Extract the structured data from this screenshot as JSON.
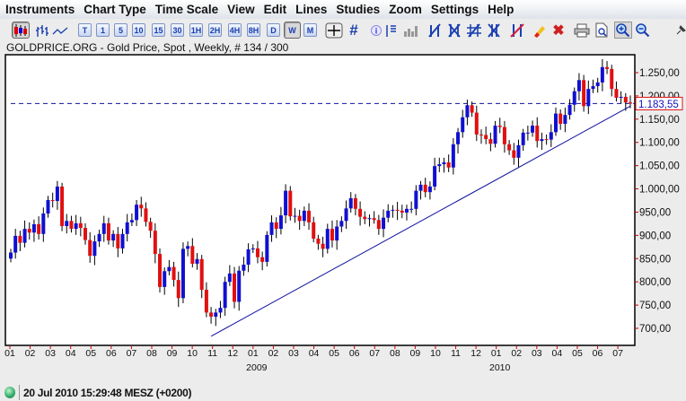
{
  "menu": [
    "Instruments",
    "Chart Type",
    "Time Scale",
    "View",
    "Edit",
    "Lines",
    "Studies",
    "Zoom",
    "Settings",
    "Help"
  ],
  "toolbar": {
    "chart_types": [
      {
        "name": "candlestick-chart-icon",
        "selected": true
      },
      {
        "name": "bar-chart-icon",
        "selected": false
      },
      {
        "name": "line-chart-icon",
        "selected": false
      }
    ],
    "timeframes": [
      {
        "label": "T",
        "selected": false
      },
      {
        "label": "1",
        "selected": false
      },
      {
        "label": "5",
        "selected": false
      },
      {
        "label": "10",
        "selected": false
      },
      {
        "label": "15",
        "selected": false
      },
      {
        "label": "30",
        "selected": false
      },
      {
        "label": "1H",
        "selected": false
      },
      {
        "label": "2H",
        "selected": false
      },
      {
        "label": "4H",
        "selected": false
      },
      {
        "label": "8H",
        "selected": false
      },
      {
        "label": "D",
        "selected": false
      },
      {
        "label": "W",
        "selected": true
      },
      {
        "label": "M",
        "selected": false
      }
    ],
    "tools": [
      "crosshair-icon",
      "grid-icon",
      "info-icon",
      "price-labels-icon",
      "volume-icon",
      "trendline-icon",
      "parallel-lines-icon",
      "fibonacci-icon",
      "fan-lines-icon",
      "channel-icon",
      "eraser-icon",
      "delete-all-icon",
      "print-icon",
      "print-preview-icon",
      "zoom-in-icon",
      "zoom-out-icon",
      "pin-icon"
    ],
    "glyphs": {
      "grid-icon": "#",
      "print-icon": "⎙",
      "pin-icon": "✎",
      "zoom-in-icon": "⊕",
      "zoom-out-icon": "⊖",
      "delete-all-icon": "✖",
      "info-icon": "ⓘ",
      "print-preview-icon": "🗋"
    }
  },
  "subtitle": "GOLDPRICE.ORG - Gold Price, Spot , Weekly, # 134 / 300",
  "colors": {
    "up": "#1010d0",
    "down": "#e01010",
    "trendline": "#1010a0",
    "price_line": "#1010a0",
    "price_box_border": "#e01010"
  },
  "chart_data": {
    "type": "candlestick",
    "instrument": "Gold Price, Spot",
    "interval": "Weekly",
    "ylim": [
      680,
      1275
    ],
    "y_ticks": [
      "700,00",
      "750,00",
      "800,00",
      "850,00",
      "900,00",
      "950,00",
      "1.000,00",
      "1.050,00",
      "1.100,00",
      "1.150,00",
      "1.200,00",
      "1.250,00"
    ],
    "y_tick_values": [
      700,
      750,
      800,
      850,
      900,
      950,
      1000,
      1050,
      1100,
      1150,
      1200,
      1250
    ],
    "x_month_labels": [
      "01",
      "02",
      "03",
      "04",
      "05",
      "06",
      "07",
      "08",
      "09",
      "10",
      "11",
      "12",
      "01",
      "02",
      "03",
      "04",
      "05",
      "06",
      "07",
      "08",
      "09",
      "10",
      "11",
      "12",
      "01",
      "02",
      "03",
      "04",
      "05",
      "06",
      "07"
    ],
    "x_year_labels": [
      {
        "label": "2009",
        "month_index": 12
      },
      {
        "label": "2010",
        "month_index": 24
      }
    ],
    "first_week_open": 850,
    "closes": [
      863,
      899,
      884,
      914,
      906,
      924,
      903,
      947,
      976,
      974,
      1005,
      920,
      931,
      914,
      926,
      916,
      890,
      856,
      887,
      903,
      926,
      889,
      903,
      872,
      903,
      928,
      933,
      966,
      958,
      929,
      910,
      860,
      789,
      823,
      832,
      804,
      765,
      871,
      877,
      839,
      849,
      783,
      734,
      725,
      734,
      744,
      800,
      818,
      757,
      824,
      837,
      870,
      872,
      853,
      843,
      901,
      928,
      914,
      943,
      996,
      941,
      942,
      931,
      953,
      928,
      893,
      882,
      871,
      914,
      889,
      919,
      931,
      958,
      980,
      957,
      940,
      935,
      937,
      933,
      914,
      938,
      953,
      955,
      953,
      949,
      957,
      957,
      996,
      1009,
      993,
      1005,
      1049,
      1053,
      1057,
      1046,
      1096,
      1122,
      1154,
      1180,
      1164,
      1117,
      1116,
      1107,
      1097,
      1136,
      1133,
      1096,
      1083,
      1067,
      1094,
      1121,
      1121,
      1136,
      1103,
      1107,
      1106,
      1122,
      1162,
      1140,
      1159,
      1181,
      1210,
      1234,
      1178,
      1215,
      1221,
      1229,
      1262,
      1258,
      1215,
      1196,
      1198,
      1186,
      1183.55
    ],
    "current_price": 1183.55,
    "current_price_label": "1.183,55",
    "trendline": {
      "from_week": 44,
      "from_value": 683,
      "to_week": 134,
      "to_value": 1178
    }
  },
  "status": {
    "connected": true,
    "time": "20 Jul 2010 15:29:48  MESZ (+0200)"
  }
}
